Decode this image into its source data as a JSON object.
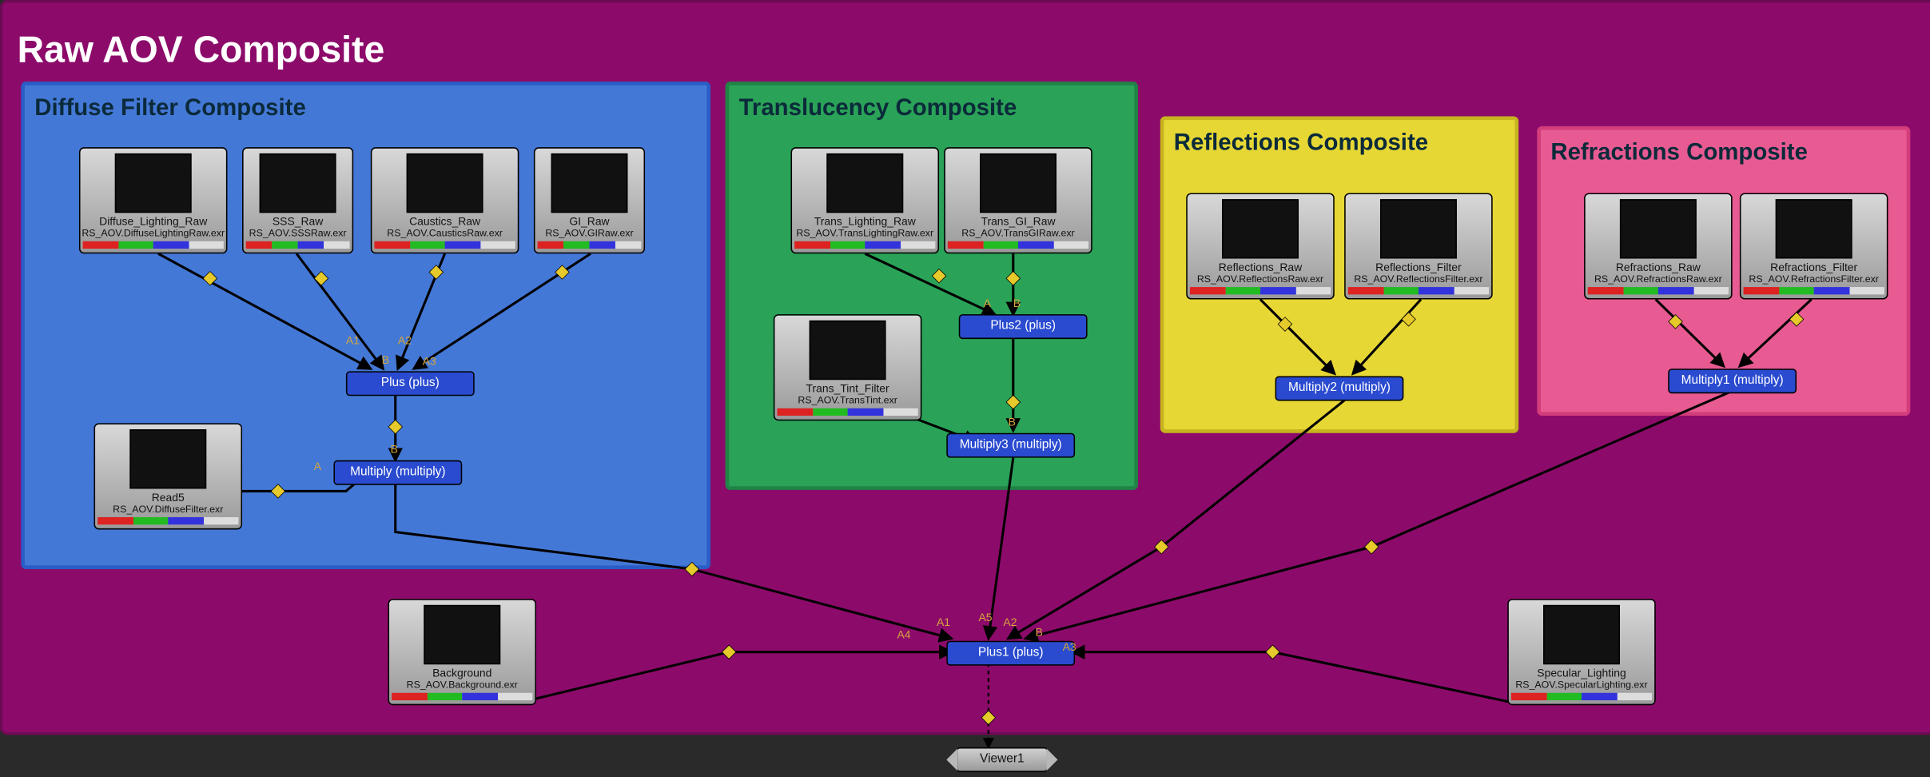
{
  "main": {
    "title": "Raw AOV Composite"
  },
  "groups": {
    "diffuse": {
      "title": "Diffuse Filter Composite"
    },
    "trans": {
      "title": "Translucency Composite"
    },
    "refl": {
      "title": "Reflections Composite"
    },
    "refr": {
      "title": "Refractions Composite"
    }
  },
  "nodes": {
    "diffuse_light": {
      "name": "Diffuse_Lighting_Raw",
      "file": "RS_AOV.DiffuseLightingRaw.exr"
    },
    "sss": {
      "name": "SSS_Raw",
      "file": "RS_AOV.SSSRaw.exr"
    },
    "caustics": {
      "name": "Caustics_Raw",
      "file": "RS_AOV.CausticsRaw.exr"
    },
    "gi": {
      "name": "GI_Raw",
      "file": "RS_AOV.GIRaw.exr"
    },
    "read5": {
      "name": "Read5",
      "file": "RS_AOV.DiffuseFilter.exr"
    },
    "trans_light": {
      "name": "Trans_Lighting_Raw",
      "file": "RS_AOV.TransLightingRaw.exr"
    },
    "trans_gi": {
      "name": "Trans_GI_Raw",
      "file": "RS_AOV.TransGIRaw.exr"
    },
    "trans_tint": {
      "name": "Trans_Tint_Filter",
      "file": "RS_AOV.TransTint.exr"
    },
    "refl_raw": {
      "name": "Reflections_Raw",
      "file": "RS_AOV.ReflectionsRaw.exr"
    },
    "refl_filt": {
      "name": "Reflections_Filter",
      "file": "RS_AOV.ReflectionsFilter.exr"
    },
    "refr_raw": {
      "name": "Refractions_Raw",
      "file": "RS_AOV.RefractionsRaw.exr"
    },
    "refr_filt": {
      "name": "Refractions_Filter",
      "file": "RS_AOV.RefractionsFilter.exr"
    },
    "background": {
      "name": "Background",
      "file": "RS_AOV.Background.exr"
    },
    "spec": {
      "name": "Specular_Lighting",
      "file": "RS_AOV.SpecularLighting.exr"
    }
  },
  "ops": {
    "plus": "Plus (plus)",
    "mult": "Multiply (multiply)",
    "plus2": "Plus2 (plus)",
    "mult3": "Multiply3 (multiply)",
    "mult2": "Multiply2 (multiply)",
    "mult1": "Multiply1 (multiply)",
    "plus1": "Plus1 (plus)"
  },
  "viewer": "Viewer1",
  "portlabels": {
    "a": "A",
    "b": "B",
    "a1": "A1",
    "a2": "A2",
    "a3": "A3",
    "a4": "A4",
    "a5": "A5"
  }
}
